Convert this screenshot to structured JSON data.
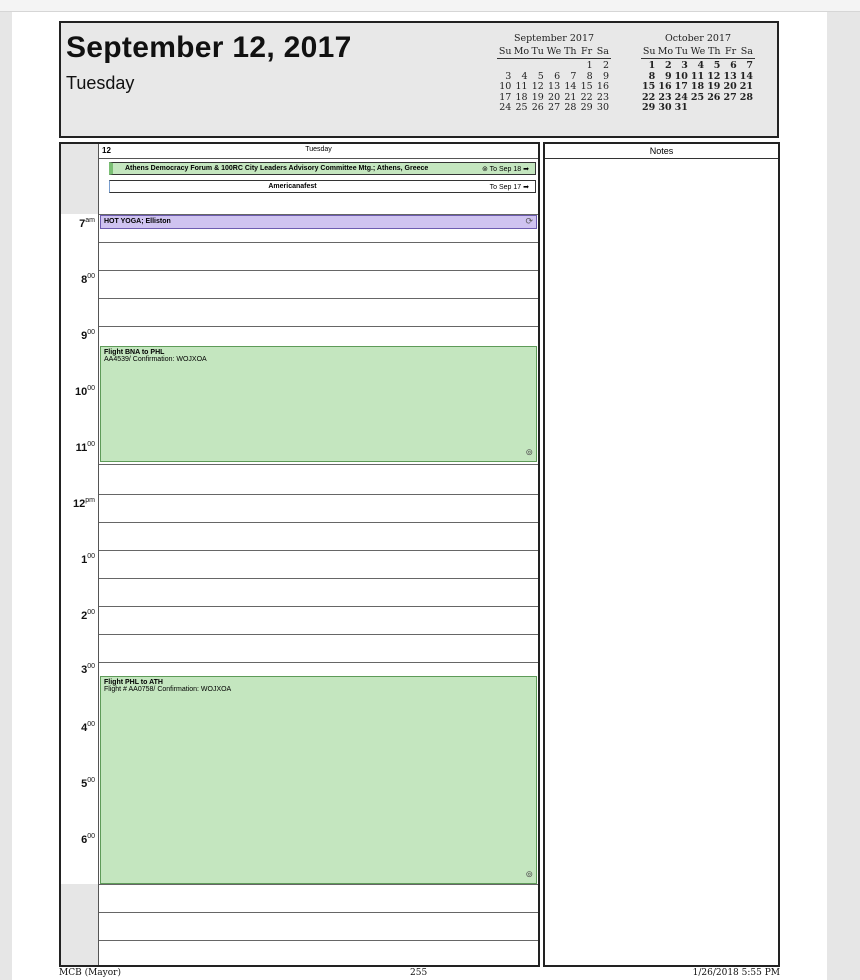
{
  "header": {
    "date_title": "September 12, 2017",
    "weekday": "Tuesday"
  },
  "mini_calendars": [
    {
      "title": "September 2017",
      "dow": [
        "Su",
        "Mo",
        "Tu",
        "We",
        "Th",
        "Fr",
        "Sa"
      ],
      "days": [
        "",
        "",
        "",
        "",
        "",
        "1",
        "2",
        "3",
        "4",
        "5",
        "6",
        "7",
        "8",
        "9",
        "10",
        "11",
        "12",
        "13",
        "14",
        "15",
        "16",
        "17",
        "18",
        "19",
        "20",
        "21",
        "22",
        "23",
        "24",
        "25",
        "26",
        "27",
        "28",
        "29",
        "30"
      ]
    },
    {
      "title": "October 2017",
      "dow": [
        "Su",
        "Mo",
        "Tu",
        "We",
        "Th",
        "Fr",
        "Sa"
      ],
      "days": [
        "1",
        "2",
        "3",
        "4",
        "5",
        "6",
        "7",
        "8",
        "9",
        "10",
        "11",
        "12",
        "13",
        "14",
        "15",
        "16",
        "17",
        "18",
        "19",
        "20",
        "21",
        "22",
        "23",
        "24",
        "25",
        "26",
        "27",
        "28",
        "29",
        "30",
        "31"
      ]
    }
  ],
  "day_header": {
    "number": "12",
    "weekday": "Tuesday"
  },
  "all_day_events": [
    {
      "title": "Athens Democracy Forum & 100RC City Leaders Advisory Committee Mtg.; Athens, Greece",
      "continues": "To Sep 18"
    },
    {
      "title": "Americanafest",
      "continues": "To Sep 17"
    }
  ],
  "hours": [
    {
      "num": "7",
      "suffix": "am"
    },
    {
      "num": "8",
      "suffix": "00"
    },
    {
      "num": "9",
      "suffix": "00"
    },
    {
      "num": "10",
      "suffix": "00"
    },
    {
      "num": "11",
      "suffix": "00"
    },
    {
      "num": "12",
      "suffix": "pm"
    },
    {
      "num": "1",
      "suffix": "00"
    },
    {
      "num": "2",
      "suffix": "00"
    },
    {
      "num": "3",
      "suffix": "00"
    },
    {
      "num": "4",
      "suffix": "00"
    },
    {
      "num": "5",
      "suffix": "00"
    },
    {
      "num": "6",
      "suffix": "00"
    }
  ],
  "appointments": [
    {
      "title": "HOT YOGA; Elliston",
      "detail": "",
      "color": "#cfc3f0"
    },
    {
      "title": "Flight BNA to PHL",
      "detail": "AA4539/ Confirmation: WOJXOA",
      "color": "#c4e6bf"
    },
    {
      "title": "Flight PHL to ATH",
      "detail": "Flight # AA0758/ Confirmation: WOJXOA",
      "color": "#c4e6bf"
    }
  ],
  "notes": {
    "title": "Notes"
  },
  "footer": {
    "owner": "MCB (Mayor)",
    "page": "255",
    "printed": "1/26/2018 5:55 PM"
  }
}
